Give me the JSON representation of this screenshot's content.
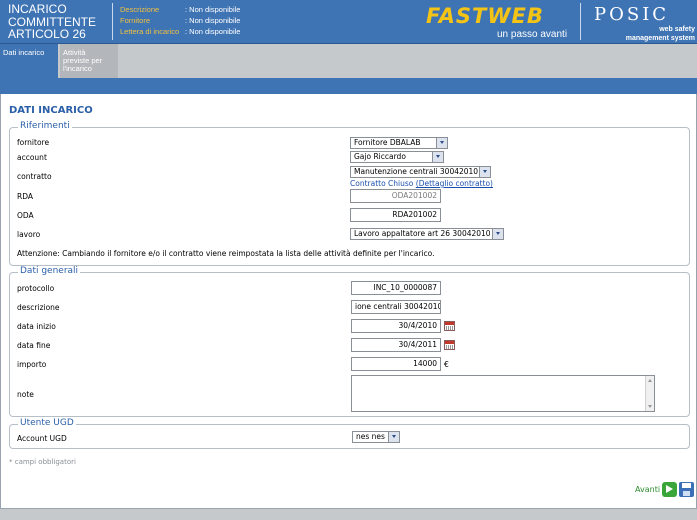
{
  "header": {
    "title_lines": [
      "INCARICO",
      "COMMITTENTE",
      "ARTICOLO 26"
    ],
    "info": [
      {
        "label": "Descrizione",
        "value": ": Non disponibile"
      },
      {
        "label": "Fornitore",
        "value": ": Non disponibile"
      },
      {
        "label": "Lettera di incarico",
        "value": ": Non disponibile"
      }
    ],
    "fastweb_logo": "FASTWEB",
    "fastweb_tagline": "un passo avanti",
    "posic_logo": "POSIC",
    "posic_tagline_1": "web safety",
    "posic_tagline_2": "management system"
  },
  "tabs": [
    {
      "lines": [
        "Dati incarico"
      ]
    },
    {
      "lines": [
        "Attività",
        "previste per",
        "l'incarico"
      ]
    }
  ],
  "page_title": "DATI INCARICO",
  "riferimenti": {
    "legend": "Riferimenti",
    "fornitore_label": "fornitore",
    "fornitore_value": "Fornitore DBALAB",
    "account_label": "account",
    "account_value": "Gajo Riccardo",
    "contratto_label": "contratto",
    "contratto_value": "Manutenzione centrali 30042010",
    "contratto_status": "Contratto Chiuso",
    "contratto_link": "(Dettaglio contratto)",
    "rda_label": "RDA",
    "rda_value": "ODA201002",
    "oda_label": "ODA",
    "oda_value": "RDA201002",
    "lavoro_label": "lavoro",
    "lavoro_value": "Lavoro appaltatore art 26 30042010",
    "warning": "Attenzione: Cambiando il fornitore e/o il contratto viene reimpostata la lista delle attività definite per l'incarico."
  },
  "dati_generali": {
    "legend": "Dati generali",
    "protocollo_label": "protocollo",
    "protocollo_value": "INC_10_0000087",
    "descrizione_label": "descrizione",
    "descrizione_value": "ione centrali 30042010",
    "data_inizio_label": "data inizio",
    "data_inizio_value": "30/4/2010",
    "data_fine_label": "data fine",
    "data_fine_value": "30/4/2011",
    "importo_label": "importo",
    "importo_value": "14000",
    "currency": "€",
    "note_label": "note"
  },
  "utente_ugd": {
    "legend": "Utente UGD",
    "account_label": "Account UGD",
    "account_value": "nes nes"
  },
  "required_note": "* campi obbligatori",
  "avanti_label": "Avanti",
  "colors": {
    "header_blue": "#3f74b4",
    "title_blue": "#2a5fa8",
    "fastweb_yellow": "#f3c316",
    "avanti_green": "#2e8b2e"
  },
  "icons": [
    "calendar-icon",
    "next-arrow-icon",
    "save-icon",
    "dropdown-arrow-icon"
  ]
}
